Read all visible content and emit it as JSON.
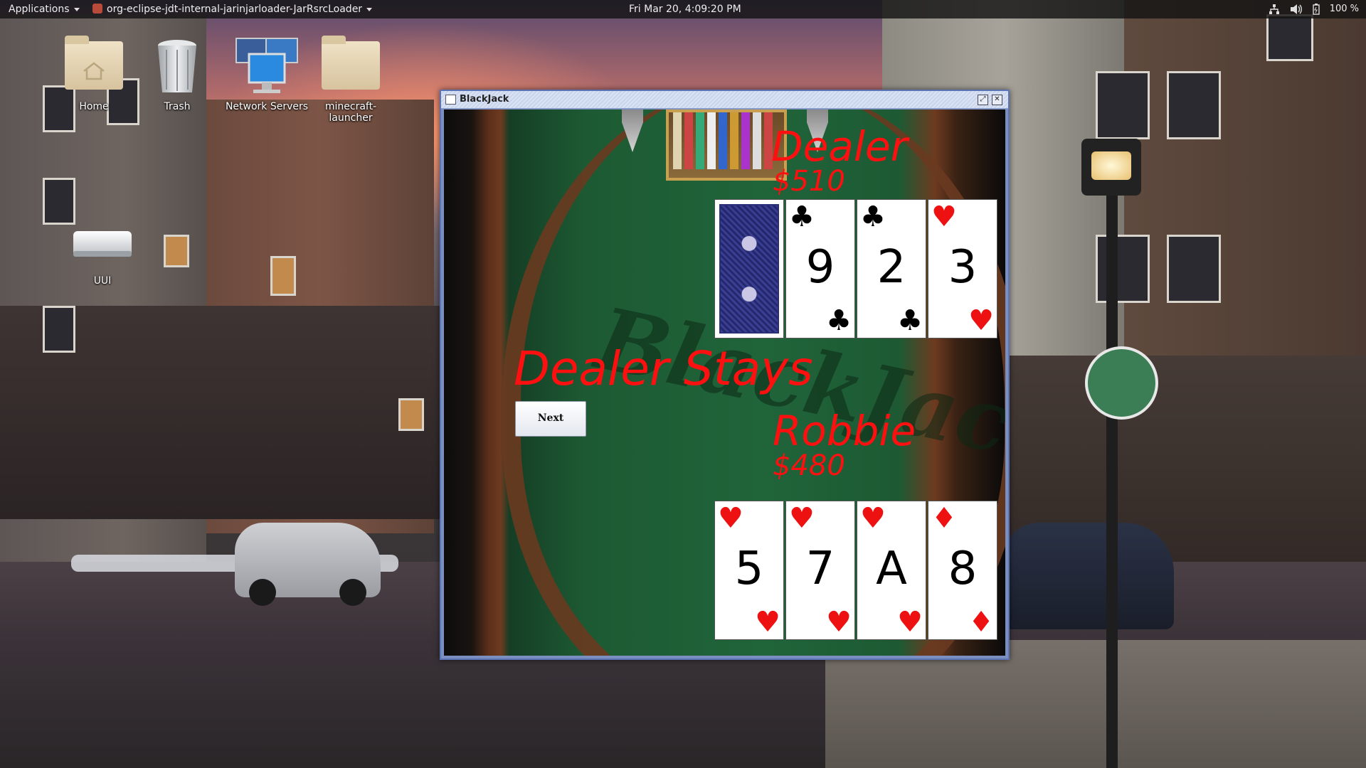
{
  "top_panel": {
    "applications_label": "Applications",
    "active_app_label": "org-eclipse-jdt-internal-jarinjarloader-JarRsrcLoader",
    "clock": "Fri Mar 20,  4:09:20 PM",
    "battery_label": "100 %"
  },
  "desktop_icons": {
    "home": "Home",
    "trash": "Trash",
    "network_servers": "Network Servers",
    "minecraft_launcher": "minecraft-launcher",
    "uui": "UUI"
  },
  "window": {
    "title": "BlackJack"
  },
  "game": {
    "dealer_name": "Dealer",
    "dealer_money": "$510",
    "status_message": "Dealer Stays",
    "next_button": "Next",
    "player_name": "Robbie",
    "player_money": "$480",
    "dealer_cards": [
      {
        "face": "back"
      },
      {
        "rank": "9",
        "suit": "♣",
        "color": "#000000"
      },
      {
        "rank": "2",
        "suit": "♣",
        "color": "#000000"
      },
      {
        "rank": "3",
        "suit": "♥",
        "color": "#ee1111"
      }
    ],
    "player_cards": [
      {
        "rank": "5",
        "suit": "♥",
        "color": "#ee1111"
      },
      {
        "rank": "7",
        "suit": "♥",
        "color": "#ee1111"
      },
      {
        "rank": "A",
        "suit": "♥",
        "color": "#ee1111"
      },
      {
        "rank": "8",
        "suit": "♦",
        "color": "#ee1111"
      }
    ],
    "accent_color": "#ff1010"
  }
}
